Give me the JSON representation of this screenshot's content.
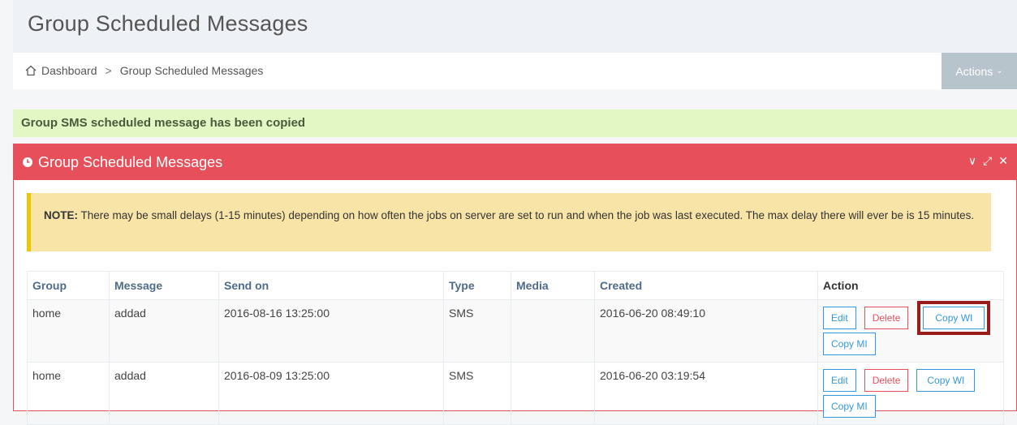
{
  "page": {
    "title": "Group Scheduled Messages"
  },
  "breadcrumb": {
    "home_icon": "home-icon",
    "dashboard": "Dashboard",
    "separator": ">",
    "current": "Group Scheduled Messages"
  },
  "header": {
    "actions_label": "Actions",
    "actions_icon": "chevron-down-icon"
  },
  "alert": {
    "message": "Group SMS scheduled message has been copied"
  },
  "portlet": {
    "icon": "clock-icon",
    "title": "Group Scheduled Messages",
    "tools": {
      "collapse": "∨",
      "fullscreen": "⤢",
      "close": "✕"
    },
    "note": {
      "label": "NOTE:",
      "text": " There may be small delays (1-15 minutes) depending on how often the jobs on server are set to run and when the job was last executed. The max delay there will ever be is 15 minutes."
    }
  },
  "table": {
    "headers": [
      "Group",
      "Message",
      "Send on",
      "Type",
      "Media",
      "Created",
      "Action"
    ],
    "rows": [
      {
        "group": "home",
        "message": "addad",
        "send_on": "2016-08-16 13:25:00",
        "type": "SMS",
        "media": "",
        "created": "2016-06-20 08:49:10",
        "actions": {
          "edit": "Edit",
          "delete": "Delete",
          "copy_wi": "Copy WI",
          "copy_mi": "Copy MI"
        }
      },
      {
        "group": "home",
        "message": "addad",
        "send_on": "2016-08-09 13:25:00",
        "type": "SMS",
        "media": "",
        "created": "2016-06-20 03:19:54",
        "actions": {
          "edit": "Edit",
          "delete": "Delete",
          "copy_wi": "Copy WI",
          "copy_mi": "Copy MI"
        }
      }
    ]
  },
  "colors": {
    "portlet_red": "#e7505a",
    "success_bg": "#e3f7c4",
    "note_bg": "#f9e4a8",
    "note_border": "#f3c200",
    "link_blue": "#3598dc",
    "highlight_box": "#9b1a1a"
  }
}
